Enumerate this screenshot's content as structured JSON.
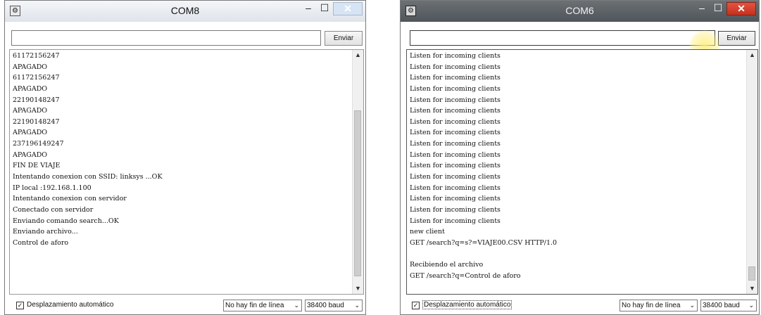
{
  "left_window": {
    "title": "COM8",
    "input_value": "",
    "send_label": "Enviar",
    "lines": [
      "61172156247",
      "APAGADO",
      "61172156247",
      "APAGADO",
      "22190148247",
      "APAGADO",
      "22190148247",
      "APAGADO",
      "237196149247",
      "APAGADO",
      "FIN DE VIAJE",
      "Intentando conexion con SSID: linksys ...OK",
      "IP local :192.168.1.100",
      "Intentando conexion con servidor",
      "Conectado con servidor",
      "Enviando comando search...OK",
      "Enviando archivo...",
      "Control de aforo"
    ],
    "autoscroll_label": "Desplazamiento automático",
    "autoscroll_checked": true,
    "line_ending": "No hay fin de línea",
    "baud": "38400 baud"
  },
  "right_window": {
    "title": "COM6",
    "input_value": "",
    "send_label": "Enviar",
    "lines": [
      "Listen for incoming clients",
      "Listen for incoming clients",
      "Listen for incoming clients",
      "Listen for incoming clients",
      "Listen for incoming clients",
      "Listen for incoming clients",
      "Listen for incoming clients",
      "Listen for incoming clients",
      "Listen for incoming clients",
      "Listen for incoming clients",
      "Listen for incoming clients",
      "Listen for incoming clients",
      "Listen for incoming clients",
      "Listen for incoming clients",
      "Listen for incoming clients",
      "Listen for incoming clients",
      "new client",
      "GET /search?q=s?=VIAJE00.CSV HTTP/1.0",
      "",
      "Recibiendo el archivo",
      "GET /search?q=Control de aforo"
    ],
    "autoscroll_label": "Desplazamiento automático",
    "autoscroll_checked": true,
    "line_ending": "No hay fin de línea",
    "baud": "38400 baud"
  },
  "icons": {
    "app": "serial-monitor-app-icon",
    "minimize": "minimize-icon",
    "maximize": "maximize-icon",
    "close": "close-icon",
    "scroll_up": "scroll-up-arrow-icon",
    "scroll_down": "scroll-down-arrow-icon",
    "dropdown": "chevron-down-icon",
    "check": "checkmark-icon",
    "mouse_pointer": "mouse-pointer-icon"
  },
  "colors": {
    "left_titlebar": "#e6eaef",
    "right_titlebar": "#5a5f63",
    "close_active": "#d0402b",
    "cursor_highlight": "#f7e97a"
  }
}
